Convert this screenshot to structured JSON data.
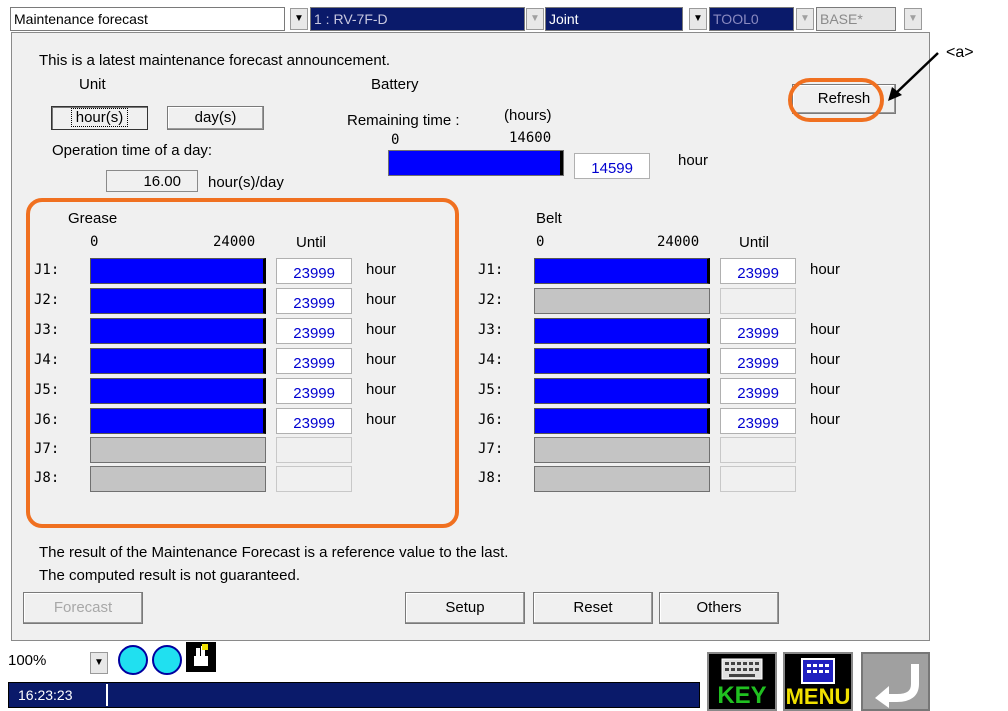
{
  "toolbar": {
    "screen_select": "Maintenance forecast",
    "robot_select": "1 : RV-7F-D",
    "jog_mode": "Joint",
    "tool": "TOOL0",
    "base": "BASE*"
  },
  "header": {
    "announcement": "This is a latest maintenance forecast announcement.",
    "unit_label": "Unit",
    "unit_hours": "hour(s)",
    "unit_days": "day(s)",
    "op_time_label": "Operation time of a day:",
    "op_time_value": "16.00",
    "op_time_unit": "hour(s)/day"
  },
  "battery": {
    "title": "Battery",
    "remaining_label": "Remaining time :",
    "units": "(hours)",
    "scale_min": "0",
    "scale_max": "14600",
    "value": "14599",
    "value_unit": "hour",
    "fill_fraction": 0.9999
  },
  "refresh_label": "Refresh",
  "callout": "<a>",
  "grease": {
    "title": "Grease",
    "scale_min": "0",
    "scale_max": "24000",
    "until_label": "Until",
    "rows": [
      {
        "joint": "J1:",
        "value": "23999",
        "unit": "hour",
        "active": true
      },
      {
        "joint": "J2:",
        "value": "23999",
        "unit": "hour",
        "active": true
      },
      {
        "joint": "J3:",
        "value": "23999",
        "unit": "hour",
        "active": true
      },
      {
        "joint": "J4:",
        "value": "23999",
        "unit": "hour",
        "active": true
      },
      {
        "joint": "J5:",
        "value": "23999",
        "unit": "hour",
        "active": true
      },
      {
        "joint": "J6:",
        "value": "23999",
        "unit": "hour",
        "active": true
      },
      {
        "joint": "J7:",
        "value": "",
        "unit": "",
        "active": false
      },
      {
        "joint": "J8:",
        "value": "",
        "unit": "",
        "active": false
      }
    ]
  },
  "belt": {
    "title": "Belt",
    "scale_min": "0",
    "scale_max": "24000",
    "until_label": "Until",
    "rows": [
      {
        "joint": "J1:",
        "value": "23999",
        "unit": "hour",
        "active": true
      },
      {
        "joint": "J2:",
        "value": "",
        "unit": "",
        "active": false
      },
      {
        "joint": "J3:",
        "value": "23999",
        "unit": "hour",
        "active": true
      },
      {
        "joint": "J4:",
        "value": "23999",
        "unit": "hour",
        "active": true
      },
      {
        "joint": "J5:",
        "value": "23999",
        "unit": "hour",
        "active": true
      },
      {
        "joint": "J6:",
        "value": "23999",
        "unit": "hour",
        "active": true
      },
      {
        "joint": "J7:",
        "value": "",
        "unit": "",
        "active": false
      },
      {
        "joint": "J8:",
        "value": "",
        "unit": "",
        "active": false
      }
    ]
  },
  "footer_note_1": "The result of the Maintenance Forecast is a reference value to the last.",
  "footer_note_2": "The computed result is not guaranteed.",
  "buttons": {
    "forecast": "Forecast",
    "setup": "Setup",
    "reset": "Reset",
    "others": "Others"
  },
  "status": {
    "zoom": "100%",
    "time": "16:23:23",
    "key_label": "KEY",
    "menu_label": "MENU"
  },
  "colors": {
    "accent_orange": "#f07020",
    "bar_blue": "#0000ff",
    "value_blue": "#0000d0",
    "title_navy": "#0a1a6a",
    "key_green": "#20c020",
    "menu_yellow": "#f0e000"
  }
}
